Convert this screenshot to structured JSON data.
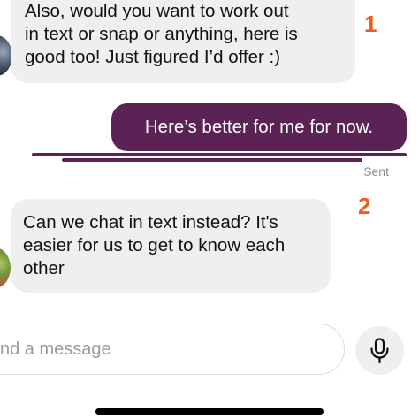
{
  "conversation": {
    "messages": [
      {
        "direction": "incoming",
        "text": "Also, would you want to work out\nin text or snap or anything, here is\ngood too! Just figured I’d offer :)"
      },
      {
        "direction": "outgoing",
        "text": "Here’s better for me for now.",
        "status": "Sent"
      },
      {
        "direction": "incoming",
        "text": "Can we chat in text instead? It's\neasier for us to get to know each\nother"
      }
    ]
  },
  "annotations": {
    "marker_1": "1",
    "marker_2": "2",
    "color": "#ef5a1e"
  },
  "composer": {
    "placeholder": "nd a message",
    "mic_icon": "microphone-icon"
  },
  "colors": {
    "outgoing_bubble": "#5b2255",
    "incoming_bubble": "#efefef"
  }
}
